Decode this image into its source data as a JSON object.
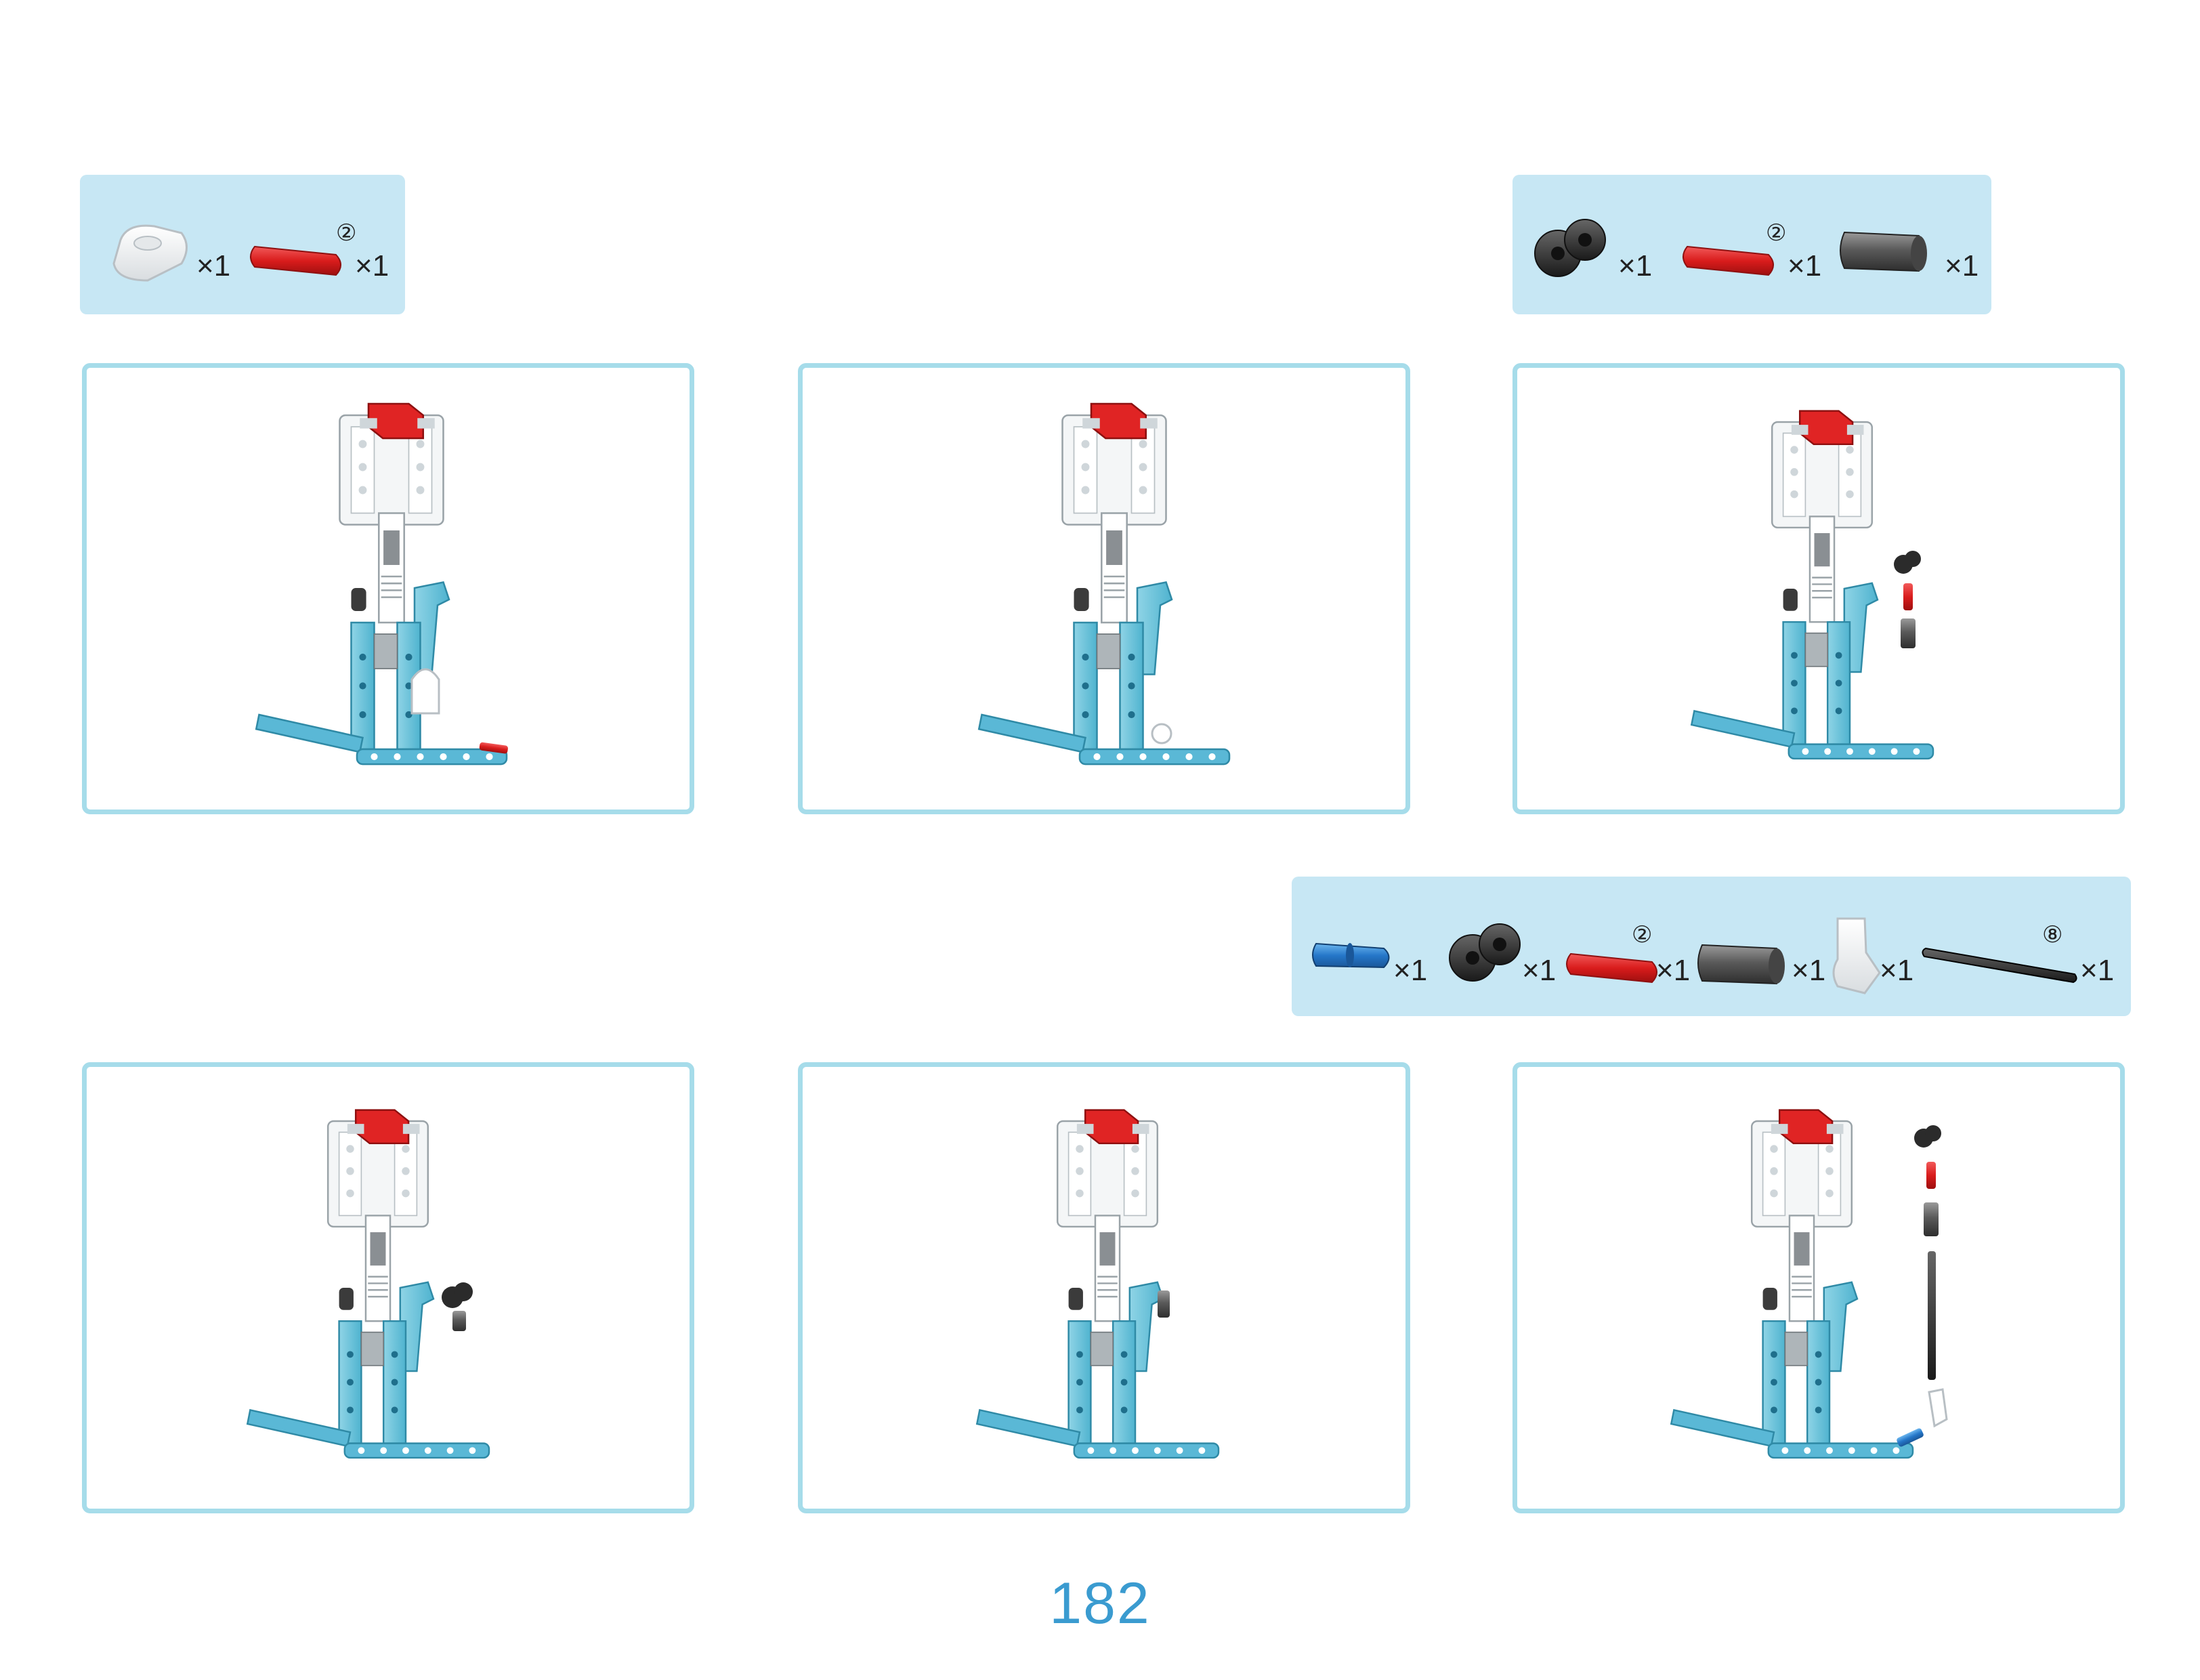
{
  "page": {
    "number": "182",
    "accent_color": "#a6dcea",
    "part_panel_color": "#c7e7f4",
    "page_number_color": "#3a9bd0"
  },
  "part_panels": [
    {
      "parts": [
        {
          "icon": "white-connector-icon",
          "qty": "×1",
          "length": ""
        },
        {
          "icon": "red-axle-icon",
          "qty": "×1",
          "length": "②"
        }
      ]
    },
    {
      "parts": [
        {
          "icon": "black-cross-block-icon",
          "qty": "×1",
          "length": ""
        },
        {
          "icon": "red-axle-icon",
          "qty": "×1",
          "length": "②"
        },
        {
          "icon": "grey-bushing-icon",
          "qty": "×1",
          "length": ""
        }
      ]
    },
    {
      "parts": [
        {
          "icon": "blue-pin-icon",
          "qty": "×1",
          "length": ""
        },
        {
          "icon": "black-cross-block-icon",
          "qty": "×1",
          "length": ""
        },
        {
          "icon": "red-axle-icon",
          "qty": "×1",
          "length": "②"
        },
        {
          "icon": "grey-bushing-icon",
          "qty": "×1",
          "length": ""
        },
        {
          "icon": "white-angle-connector-icon",
          "qty": "×1",
          "length": ""
        },
        {
          "icon": "black-long-axle-icon",
          "qty": "×1",
          "length": "⑧"
        }
      ]
    }
  ],
  "steps": [
    {
      "illustration": "robot-leg-assembly-step-1"
    },
    {
      "illustration": "robot-leg-assembly-step-2"
    },
    {
      "illustration": "robot-leg-assembly-step-3"
    },
    {
      "illustration": "robot-leg-assembly-step-4"
    },
    {
      "illustration": "robot-leg-assembly-step-5"
    },
    {
      "illustration": "robot-leg-assembly-step-6"
    }
  ]
}
